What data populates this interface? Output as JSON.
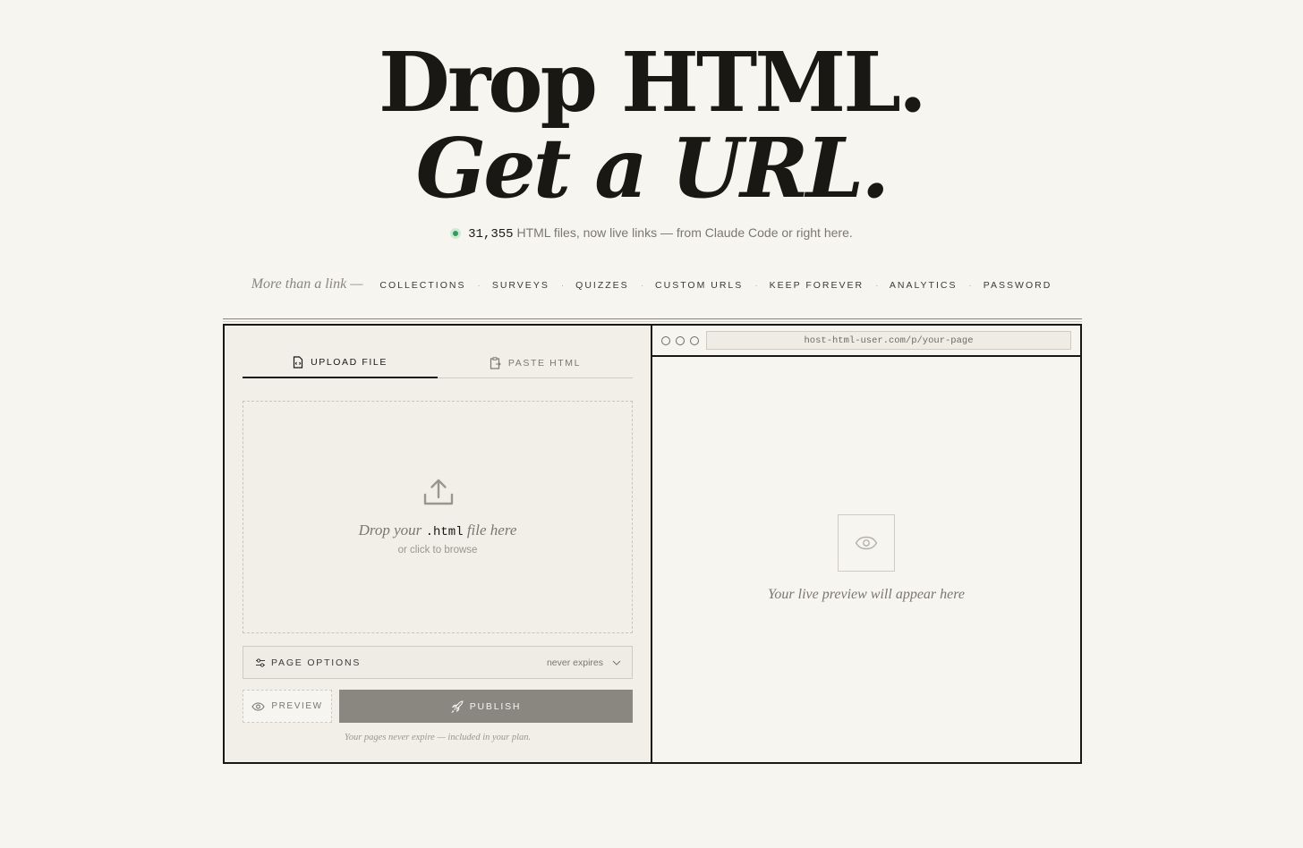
{
  "hero": {
    "line1": "Drop HTML.",
    "line2": "Get a URL."
  },
  "stat": {
    "count": "31,355",
    "text": " HTML files, now live links — from Claude Code or right here."
  },
  "features": {
    "lead": "More than a link —",
    "items": [
      "COLLECTIONS",
      "SURVEYS",
      "QUIZZES",
      "CUSTOM URLS",
      "KEEP FOREVER",
      "ANALYTICS",
      "PASSWORD"
    ],
    "separator": "·"
  },
  "tabs": {
    "upload": "UPLOAD FILE",
    "paste": "PASTE HTML",
    "active": "upload"
  },
  "dropzone": {
    "title_before": "Drop your ",
    "title_code": ".html",
    "title_after": " file here",
    "subtitle": "or click to browse",
    "icon": "upload-icon"
  },
  "options": {
    "label": "PAGE OPTIONS",
    "value": "never expires",
    "icon": "sliders-icon"
  },
  "buttons": {
    "preview": "PREVIEW",
    "publish": "PUBLISH"
  },
  "footnote": "Your pages never expire — included in your plan.",
  "browser": {
    "url": "host-html-user.com/p/your-page",
    "placeholder_text": "Your live preview will appear here"
  },
  "colors": {
    "background": "#f7f5f0",
    "ink": "#1a1815",
    "status_green": "#2e9e57",
    "publish_button": "#8a8680"
  }
}
